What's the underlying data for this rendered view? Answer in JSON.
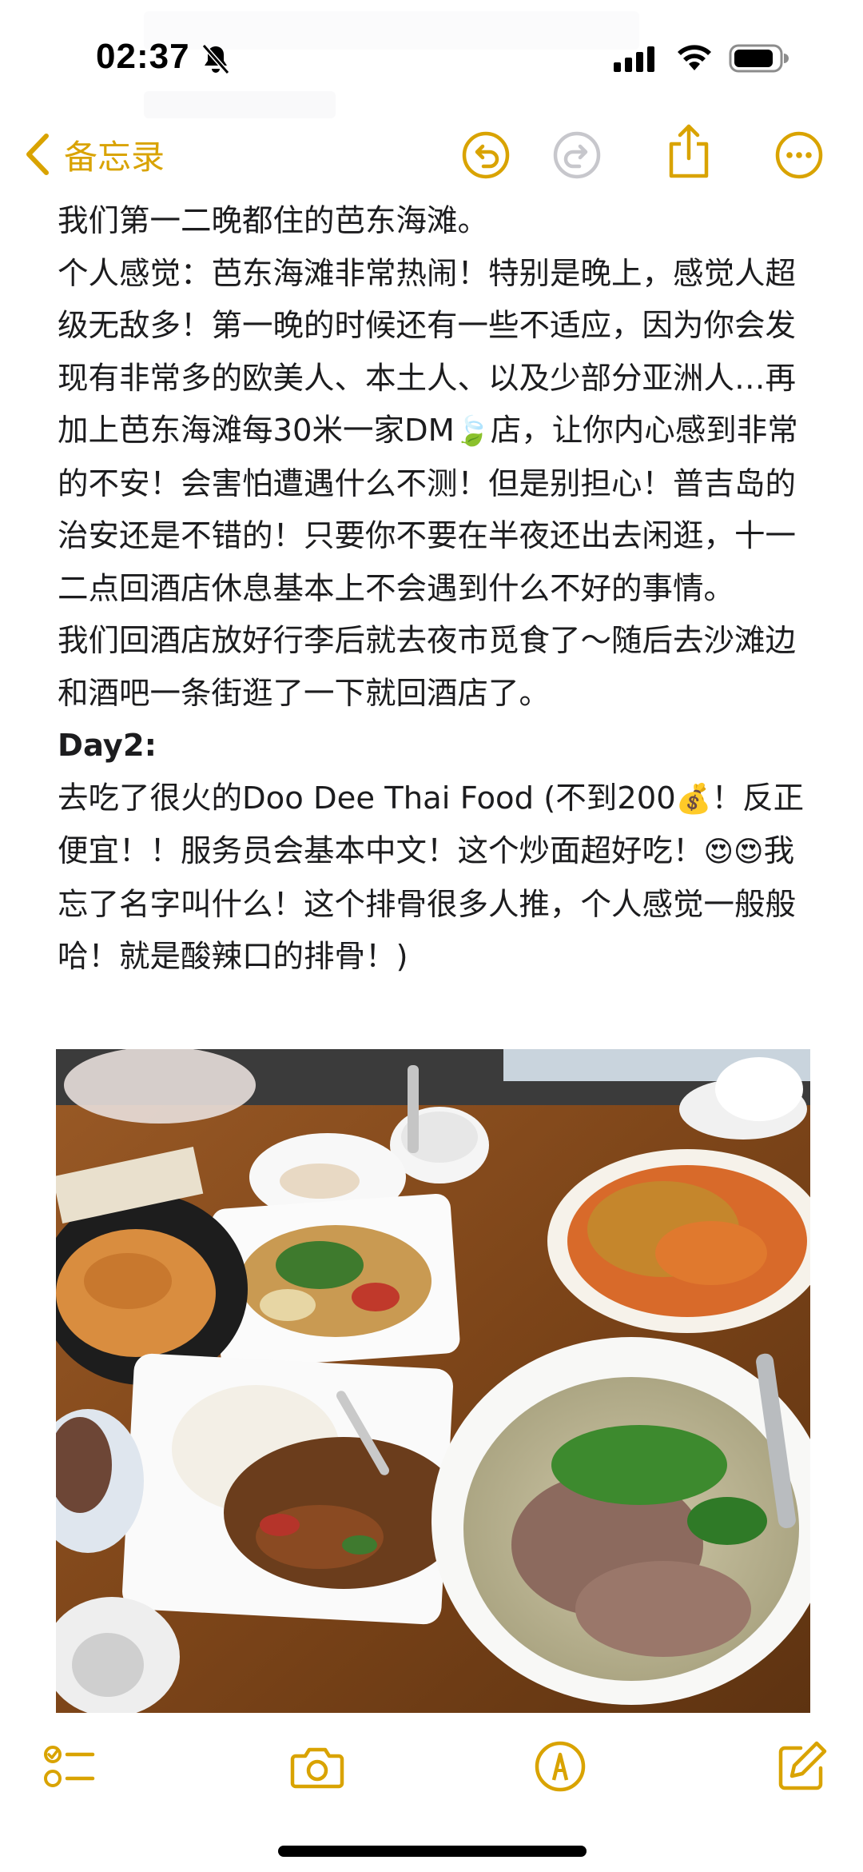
{
  "status_bar": {
    "time": "02:37"
  },
  "nav": {
    "back_label": "备忘录"
  },
  "note": {
    "paragraphs_before": [
      "我们第一二晚都住的芭东海滩。",
      "个人感觉：芭东海滩非常热闹！特别是晚上，感觉人超级无敌多！第一晚的时候还有一些不适应，因为你会发现有非常多的欧美人、本土人、以及少部分亚洲人…再加上芭东海滩每30米一家DM",
      "店，让你内心感到非常的不安！会害怕遭遇什么不测！但是别担心！普吉岛的治安还是不错的！只要你不要在半夜还出去闲逛，十一二点回酒店休息基本上不会遇到什么不好的事情。",
      "我们回酒店放好行李后就去夜市觅食了～随后去沙滩边和酒吧一条街逛了一下就回酒店了。"
    ],
    "leaf_emoji": "🍃",
    "day_heading": "Day2:",
    "day2_part1": "去吃了很火的Doo Dee Thai Food (不到200",
    "money_emoji": "💰",
    "day2_part2": "！反正便宜！！服务员会基本中文！这个炒面超好吃！",
    "heart_eyes": "😍😍",
    "day2_part3": "我忘了名字叫什么！这个排骨很多人推，个人感觉一般般哈！就是酸辣口的排骨！)"
  },
  "icons": {
    "back": "chevron-left-icon",
    "undo": "undo-icon",
    "redo": "redo-icon",
    "share": "share-icon",
    "more": "more-icon",
    "checklist": "checklist-icon",
    "camera": "camera-icon",
    "markup": "markup-pen-icon",
    "compose": "compose-icon"
  },
  "colors": {
    "accent": "#d9a300",
    "disabled": "#c7c7cc",
    "text": "#1c1c1e"
  }
}
